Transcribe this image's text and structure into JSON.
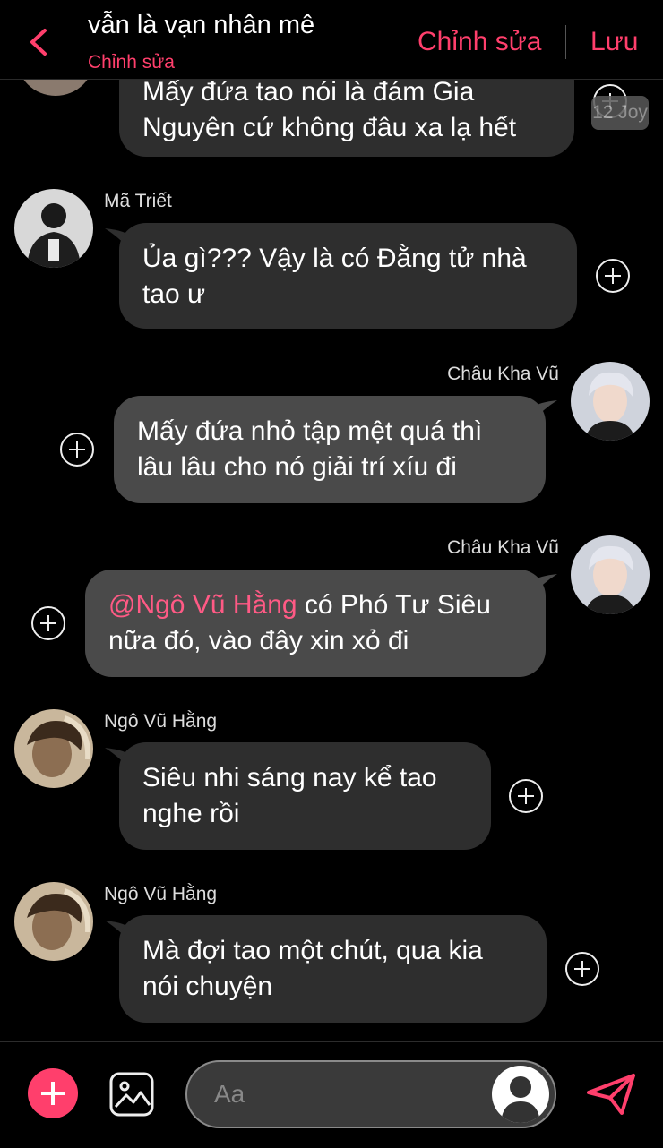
{
  "header": {
    "title": "vẫn là vạn nhân mê",
    "subtitle": "Chỉnh sửa",
    "edit_label": "Chỉnh sửa",
    "save_label": "Lưu",
    "accent_color": "#ff3f6c"
  },
  "top_partial_message": {
    "line1": "Mấy đứa tao nói là đám Gia",
    "line2": "Nguyên cứ không đâu xa lạ hết",
    "time_badge": "12 Joy"
  },
  "messages": [
    {
      "sender": "Mã Triết",
      "direction": "incoming",
      "avatar_icon": "person-dark-outfit-avatar",
      "line1": "Ủa gì??? Vậy là có Đằng tử nhà",
      "line2": "tao ư"
    },
    {
      "sender": "Châu Kha Vũ",
      "direction": "outgoing",
      "avatar_icon": "silver-hair-avatar",
      "line1": "Mấy đứa nhỏ tập mệt quá thì",
      "line2": "lâu lâu cho nó giải trí xíu đi"
    },
    {
      "sender": "Châu Kha Vũ",
      "direction": "outgoing",
      "avatar_icon": "silver-hair-avatar",
      "mention": "@Ngô Vũ Hằng",
      "line1_rest": " có Phó Tư Siêu",
      "line2": "nữa đó, vào đây xin xỏ đi"
    },
    {
      "sender": "Ngô Vũ Hằng",
      "direction": "incoming",
      "avatar_icon": "sepia-portrait-avatar",
      "line1": "Siêu nhi sáng nay kể tao",
      "line2": "nghe rồi"
    },
    {
      "sender": "Ngô Vũ Hằng",
      "direction": "incoming",
      "avatar_icon": "sepia-portrait-avatar",
      "line1": "Mà đợi tao một chút, qua kia",
      "line2": "nói chuyện"
    }
  ],
  "composer": {
    "placeholder": "Aa",
    "plus_icon": "plus-icon",
    "image_icon": "image-icon",
    "send_icon": "send-icon"
  }
}
